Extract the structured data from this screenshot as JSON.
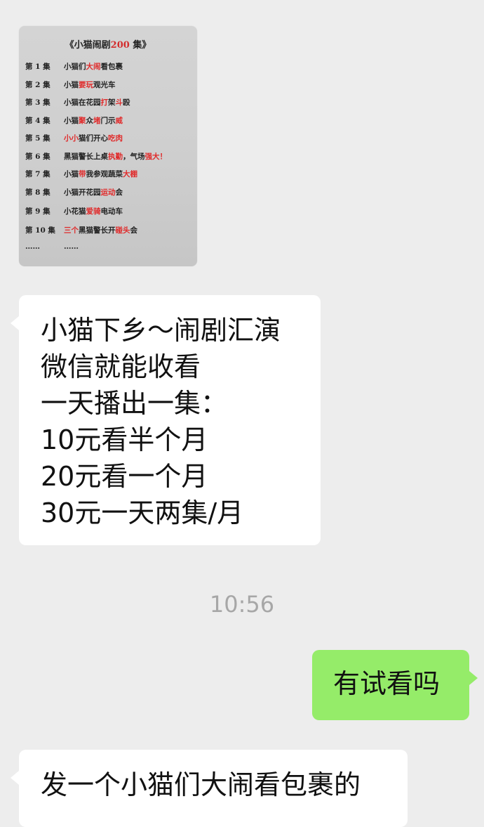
{
  "image_message": {
    "title_prefix": "《小猫闹剧",
    "title_number": "200",
    "title_suffix": " 集》",
    "episodes": [
      {
        "no": "第 1 集",
        "parts": [
          {
            "t": "小猫们"
          },
          {
            "t": "大闹",
            "red": true
          },
          {
            "t": "看包裹"
          }
        ]
      },
      {
        "no": "第 2 集",
        "parts": [
          {
            "t": "小猫"
          },
          {
            "t": "要玩",
            "red": true
          },
          {
            "t": "观光车"
          }
        ]
      },
      {
        "no": "第 3 集",
        "parts": [
          {
            "t": "小猫在花园"
          },
          {
            "t": "打",
            "red": true
          },
          {
            "t": "架"
          },
          {
            "t": "斗",
            "red": true
          },
          {
            "t": "殴"
          }
        ]
      },
      {
        "no": "第 4 集",
        "parts": [
          {
            "t": "小猫"
          },
          {
            "t": "聚",
            "red": true
          },
          {
            "t": "众"
          },
          {
            "t": "堵",
            "red": true
          },
          {
            "t": "门示"
          },
          {
            "t": "威",
            "red": true
          }
        ]
      },
      {
        "no": "第 5 集",
        "parts": [
          {
            "t": "小小",
            "red": true
          },
          {
            "t": "猫们开心"
          },
          {
            "t": "吃肉",
            "red": true
          }
        ]
      },
      {
        "no": "第 6 集",
        "parts": [
          {
            "t": "黑猫警长上桌"
          },
          {
            "t": "执勤",
            "red": true
          },
          {
            "t": "，气场"
          },
          {
            "t": "强大！",
            "red": true
          }
        ]
      },
      {
        "no": "第 7 集",
        "parts": [
          {
            "t": "小猫"
          },
          {
            "t": "带",
            "red": true
          },
          {
            "t": "我参观蔬菜"
          },
          {
            "t": "大棚",
            "red": true
          }
        ]
      },
      {
        "no": "第 8 集",
        "parts": [
          {
            "t": "小猫开花园"
          },
          {
            "t": "运动",
            "red": true
          },
          {
            "t": "会"
          }
        ]
      },
      {
        "no": "第 9 集",
        "parts": [
          {
            "t": "小花猫"
          },
          {
            "t": "爱骑",
            "red": true
          },
          {
            "t": "电动车"
          }
        ]
      },
      {
        "no": "第 10 集",
        "parts": [
          {
            "t": "三个",
            "red": true
          },
          {
            "t": "黑猫警长开"
          },
          {
            "t": "碰头",
            "red": true
          },
          {
            "t": "会"
          }
        ]
      },
      {
        "no": "……",
        "parts": [
          {
            "t": "……"
          }
        ]
      }
    ]
  },
  "messages": {
    "m1_lines": [
      "小猫下乡～闹剧汇演",
      "微信就能收看",
      "一天播出一集：",
      "10元看半个月",
      "20元看一个月",
      "30元一天两集/月"
    ],
    "timestamp": "10:56",
    "m2": "有试看吗",
    "m3": "发一个小猫们大闹看包裹的"
  },
  "colors": {
    "background": "#ededed",
    "incoming_bubble": "#ffffff",
    "outgoing_bubble": "#95ec69",
    "poster_red": "#e02a2a"
  }
}
